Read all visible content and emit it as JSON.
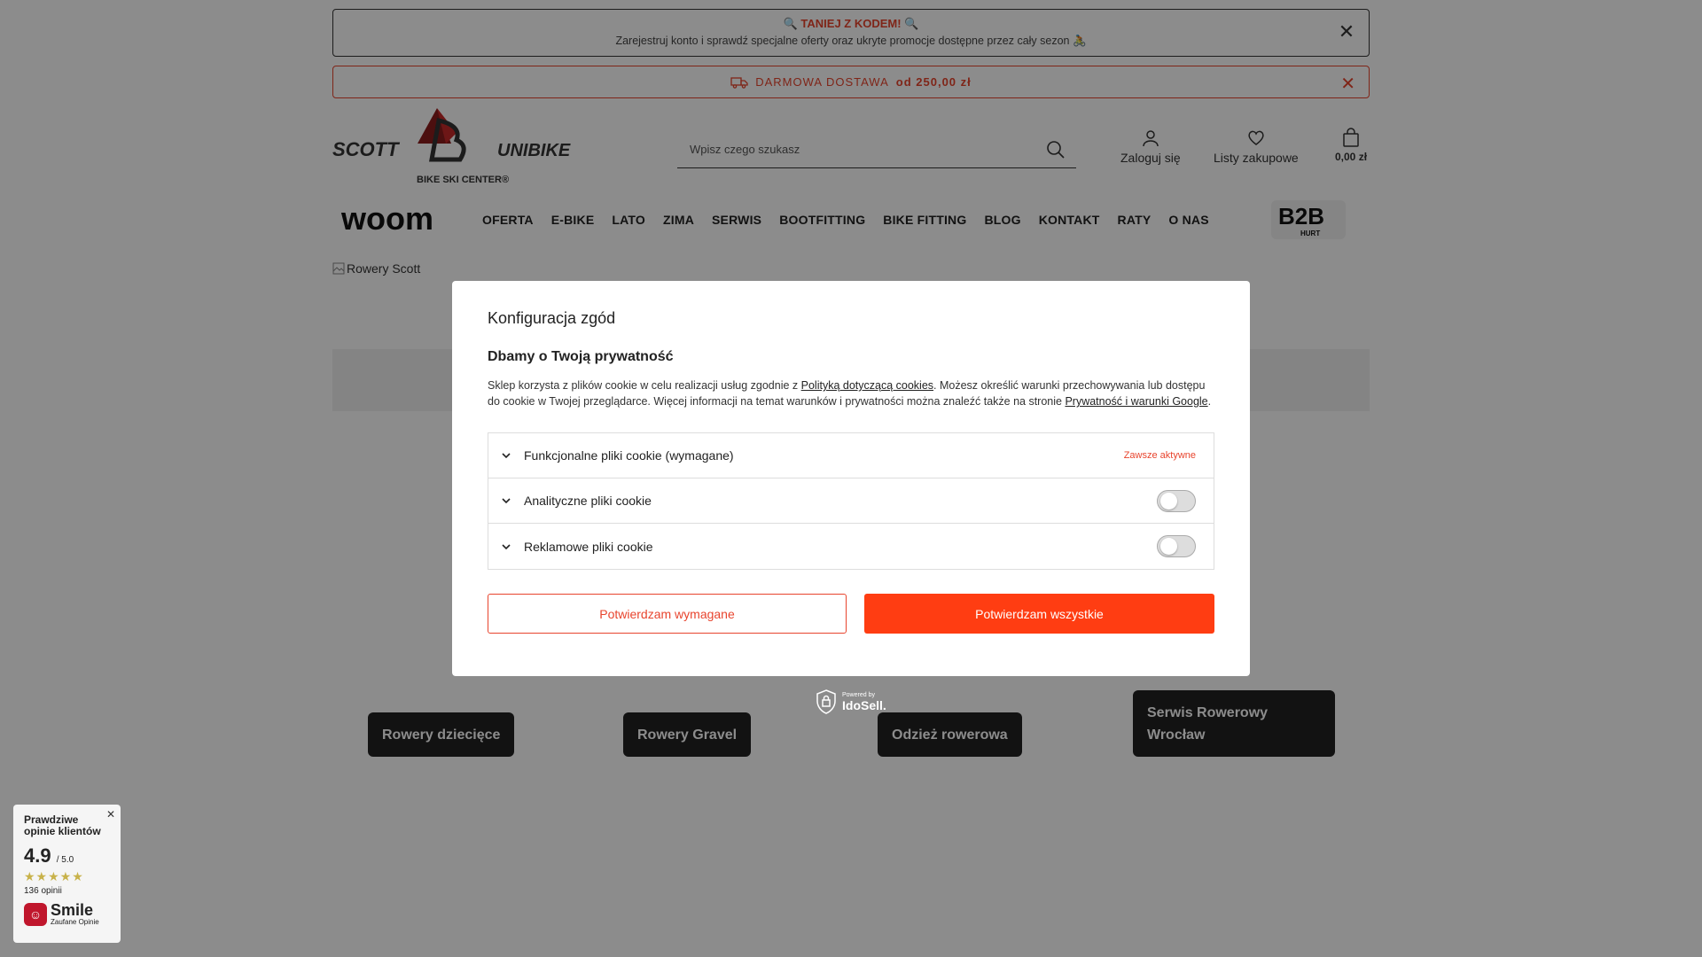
{
  "promo": {
    "title": "🔍 TANIEJ Z KODEM! 🔍",
    "text": "Zarejestruj konto i sprawdź specjalne oferty oraz ukryte promocje dostępne przez cały sezon 🚴",
    "close": "✕"
  },
  "shipping": {
    "text": "DARMOWA DOSTAWA",
    "bold": "od 250,00 zł",
    "close": "✕"
  },
  "logo": {
    "left": "SCOTT",
    "right": "UNIBIKE",
    "sub": "BIKE SKI CENTER®"
  },
  "search": {
    "placeholder": "Wpisz czego szukasz",
    "icon": "search-icon"
  },
  "header": {
    "login": "Zaloguj się",
    "wishlist": "Listy zakupowe",
    "cart": "0,00 zł"
  },
  "nav": {
    "woom": "woom",
    "items": [
      "OFERTA",
      "E-BIKE",
      "LATO",
      "ZIMA",
      "SERWIS",
      "BOOTFITTING",
      "BIKE FITTING",
      "BLOG",
      "KONTAKT",
      "RATY",
      "O NAS"
    ],
    "b2b": "B2B",
    "b2b_sub": "HURT"
  },
  "banner_alt": "Rowery Scott",
  "categories": [
    "Rowery dziecięce",
    "Rowery Gravel",
    "Odzież rowerowa",
    "Serwis Rowerowy Wrocław"
  ],
  "modal": {
    "title": "Konfiguracja zgód",
    "heading": "Dbamy o Twoją prywatność",
    "text1": "Sklep korzysta z plików cookie w celu realizacji usług zgodnie z ",
    "link1": "Polityką dotyczącą cookies",
    "text2": ". Możesz określić warunki przechowywania lub dostępu do cookie w Twojej przeglądarce. Więcej informacji na temat warunków i prywatności można znaleźć także na stronie ",
    "link2": "Prywatność i warunki Google",
    "text3": ".",
    "rows": [
      {
        "label": "Funkcjonalne pliki cookie (wymagane)",
        "status": "Zawsze aktywne"
      },
      {
        "label": "Analityczne pliki cookie",
        "enabled": false
      },
      {
        "label": "Reklamowe pliki cookie",
        "enabled": false
      }
    ],
    "btn_required": "Potwierdzam wymagane",
    "btn_all": "Potwierdzam wszystkie"
  },
  "powered": {
    "small": "Powered by",
    "brand": "IdoSell."
  },
  "smile": {
    "title": "Prawdziwe opinie klientów",
    "score": "4.9",
    "max": "/ 5.0",
    "stars": "★★★★★",
    "count": "136 opinii",
    "brand": "Smile",
    "brand_sub": "Zaufane Opinie",
    "close": "✕"
  },
  "colors": {
    "accent": "#e8442d",
    "button": "#ff3d12"
  }
}
